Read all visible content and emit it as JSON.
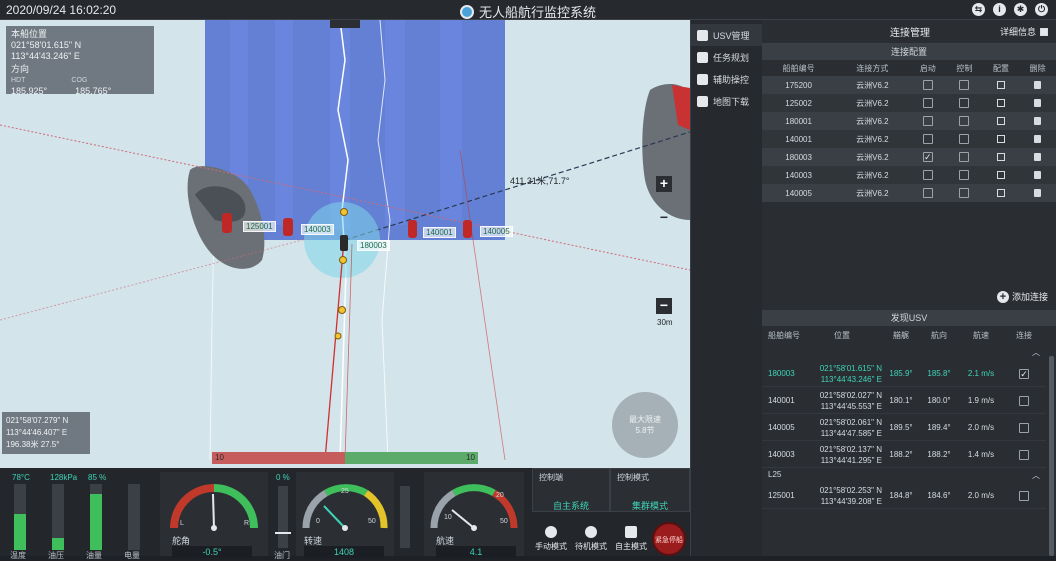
{
  "topbar": {
    "datetime": "2020/09/24 16:02:20",
    "title": "无人船航行监控系统",
    "icons": [
      "swap-icon",
      "info-icon",
      "settings-icon",
      "power-icon"
    ]
  },
  "map": {
    "own_position_title": "本船位置",
    "lat": "021°58'01.615\" N",
    "lon": "113°44'43.246\" E",
    "heading_title": "方向",
    "hdt_label": "HDT",
    "cog_label": "COG",
    "hdt": "185.925°",
    "cog": "185.765°",
    "distance_label": "411.31米,71.7°",
    "boats": [
      "125001",
      "140003",
      "180003",
      "140001",
      "140005"
    ],
    "cursor_lat": "021°58'07.279\" N",
    "cursor_lon": "113°44'46.407\" E",
    "cursor_dist": "196.38米 27.5°",
    "scale": "30m",
    "speed_limit_label": "最大限速",
    "speed_limit_value": "5.8节",
    "rudder_left": "10",
    "rudder_right": "10"
  },
  "tabs": [
    {
      "label": "USV管理",
      "icon": "ship-icon",
      "active": true
    },
    {
      "label": "任务规划",
      "icon": "task-icon",
      "active": false
    },
    {
      "label": "辅助操控",
      "icon": "control-icon",
      "active": false
    },
    {
      "label": "地图下载",
      "icon": "download-icon",
      "active": false
    }
  ],
  "connection": {
    "title": "连接管理",
    "detail_label": "详细信息",
    "config_title": "连接配置",
    "headers": [
      "船舶编号",
      "连接方式",
      "启动",
      "控制",
      "配置",
      "删除"
    ],
    "rows": [
      {
        "id": "175200",
        "method": "云洲V6.2",
        "start": false
      },
      {
        "id": "125002",
        "method": "云洲V6.2",
        "start": false
      },
      {
        "id": "180001",
        "method": "云洲V6.2",
        "start": false
      },
      {
        "id": "140001",
        "method": "云洲V6.2",
        "start": false
      },
      {
        "id": "180003",
        "method": "云洲V6.2",
        "start": true
      },
      {
        "id": "140003",
        "method": "云洲V6.2",
        "start": false
      },
      {
        "id": "140005",
        "method": "云洲V6.2",
        "start": false
      }
    ],
    "add_label": "添加连接"
  },
  "discovery": {
    "title": "发现USV",
    "headers": [
      "船舶编号",
      "位置",
      "艏艉",
      "航向",
      "航速",
      "连接"
    ],
    "group1_rows": [
      {
        "id": "180003",
        "lat": "021°58'01.615\" N",
        "lon": "113°44'43.246\" E",
        "bow": "185.9°",
        "course": "185.8°",
        "speed": "2.1 m/s",
        "connected": true
      },
      {
        "id": "140001",
        "lat": "021°58'02.027\" N",
        "lon": "113°44'45.553\" E",
        "bow": "180.1°",
        "course": "180.0°",
        "speed": "1.9 m/s",
        "connected": false
      },
      {
        "id": "140005",
        "lat": "021°58'02.061\" N",
        "lon": "113°44'47.585\" E",
        "bow": "189.5°",
        "course": "189.4°",
        "speed": "2.0 m/s",
        "connected": false
      },
      {
        "id": "140003",
        "lat": "021°58'02.137\" N",
        "lon": "113°44'41.295\" E",
        "bow": "188.2°",
        "course": "188.2°",
        "speed": "1.4 m/s",
        "connected": false
      }
    ],
    "group2_label": "L25",
    "group2_rows": [
      {
        "id": "125001",
        "lat": "021°58'02.253\" N",
        "lon": "113°44'39.208\" E",
        "bow": "184.8°",
        "course": "184.6°",
        "speed": "2.0 m/s",
        "connected": false
      }
    ]
  },
  "dashboard": {
    "bars": [
      {
        "top": "78°C",
        "bottom": "温度",
        "level": 0.55
      },
      {
        "top": "128kPa",
        "bottom": "油压",
        "level": 0.18
      },
      {
        "top": "85 %",
        "bottom": "油量",
        "level": 0.85
      },
      {
        "top": "",
        "bottom": "电量",
        "level": 0.0
      }
    ],
    "rudder_label": "舵角",
    "rudder_value": "-0.5°",
    "rudder_L": "L",
    "rudder_R": "R",
    "throttle_top": "0 %",
    "throttle_bottom": "油门",
    "rpm_label": "转速",
    "rpm_value": "1408",
    "rpm_ticks": [
      "0",
      "25",
      "50"
    ],
    "speed_label": "航速",
    "speed_value": "4.1",
    "speed_ticks": [
      "10",
      "20",
      "50"
    ],
    "control_end_label": "控制端",
    "control_end_value": "自主系统",
    "control_mode_label": "控制模式",
    "control_mode_value": "集群模式",
    "modes": [
      "手动模式",
      "待机模式",
      "自主模式"
    ],
    "estop_label": "紧急停船",
    "colors": {
      "accent": "#3fd3b8",
      "green": "#3fbf5c",
      "red": "#c0392b",
      "yellow": "#e3c32a"
    }
  }
}
